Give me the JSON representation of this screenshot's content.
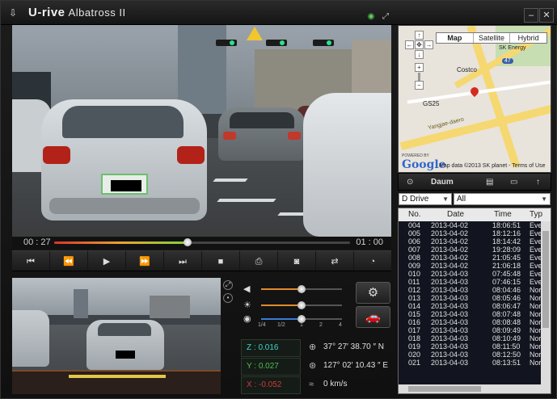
{
  "app": {
    "title": "U-rive",
    "subtitle": "Albatross II",
    "minimize": "–",
    "close": "✕"
  },
  "timeline": {
    "current": "00 : 27",
    "total": "01 : 00",
    "progress": 0.45
  },
  "controls": [
    {
      "name": "skip-start-button",
      "icon": "⏮"
    },
    {
      "name": "rewind-button",
      "icon": "⏪"
    },
    {
      "name": "play-button",
      "icon": "▶"
    },
    {
      "name": "fast-forward-button",
      "icon": "⏩"
    },
    {
      "name": "skip-end-button",
      "icon": "⏭"
    },
    {
      "name": "stop-button",
      "icon": "■"
    },
    {
      "name": "print-button",
      "icon": "⎙"
    },
    {
      "name": "camera-button",
      "icon": "◙"
    },
    {
      "name": "swap-button",
      "icon": "⇄"
    },
    {
      "name": "speedometer-button",
      "icon": "◔"
    }
  ],
  "sliders": {
    "volume": 0.5,
    "brightness": 0.5,
    "speed": 0.5
  },
  "speed_labels": [
    "1/4",
    "1/2",
    "1",
    "2",
    "4"
  ],
  "gsensor": {
    "z": "Z : 0.016",
    "y": "Y : 0.027",
    "x": "X : -0.052"
  },
  "gps": {
    "lat": "37° 27′ 38.70 ″ N",
    "lon": "127° 02′ 10.43 ″ E",
    "speed": "0 km/s"
  },
  "map": {
    "tabs": [
      "Map",
      "Satellite",
      "Hybrid"
    ],
    "labels": {
      "skenergy": "SK Energy",
      "costco": "Costco",
      "gs25": "GS25",
      "road": "Yangjae-daero",
      "badge": "47"
    },
    "powered": "POWERED BY",
    "logo": "Google",
    "attribution": "Map data ©2013 SK planet - Terms of Use"
  },
  "toolbar": {
    "provider": "Daum"
  },
  "drive_select": "D Drive",
  "filter_select": "All",
  "table": {
    "headers": [
      "No.",
      "Date",
      "Time",
      "Typ"
    ],
    "rows": [
      [
        "004",
        "2013-04-02",
        "18:06:51",
        "Eve"
      ],
      [
        "005",
        "2013-04-02",
        "18:12:16",
        "Eve"
      ],
      [
        "006",
        "2013-04-02",
        "18:14:42",
        "Eve"
      ],
      [
        "007",
        "2013-04-02",
        "19:28:09",
        "Eve"
      ],
      [
        "008",
        "2013-04-02",
        "21:05:45",
        "Eve"
      ],
      [
        "009",
        "2013-04-02",
        "21:06:18",
        "Eve"
      ],
      [
        "010",
        "2013-04-03",
        "07:45:48",
        "Eve"
      ],
      [
        "011",
        "2013-04-03",
        "07:46:15",
        "Eve"
      ],
      [
        "012",
        "2013-04-03",
        "08:04:46",
        "Nor"
      ],
      [
        "013",
        "2013-04-03",
        "08:05:46",
        "Nor"
      ],
      [
        "014",
        "2013-04-03",
        "08:06:47",
        "Nor"
      ],
      [
        "015",
        "2013-04-03",
        "08:07:48",
        "Nor"
      ],
      [
        "016",
        "2013-04-03",
        "08:08:48",
        "Nor"
      ],
      [
        "017",
        "2013-04-03",
        "08:09:49",
        "Nor"
      ],
      [
        "018",
        "2013-04-03",
        "08:10:49",
        "Nor"
      ],
      [
        "019",
        "2013-04-03",
        "08:11:50",
        "Nor"
      ],
      [
        "020",
        "2013-04-03",
        "08:12:50",
        "Nor"
      ],
      [
        "021",
        "2013-04-03",
        "08:13:51",
        "Nor"
      ]
    ]
  }
}
